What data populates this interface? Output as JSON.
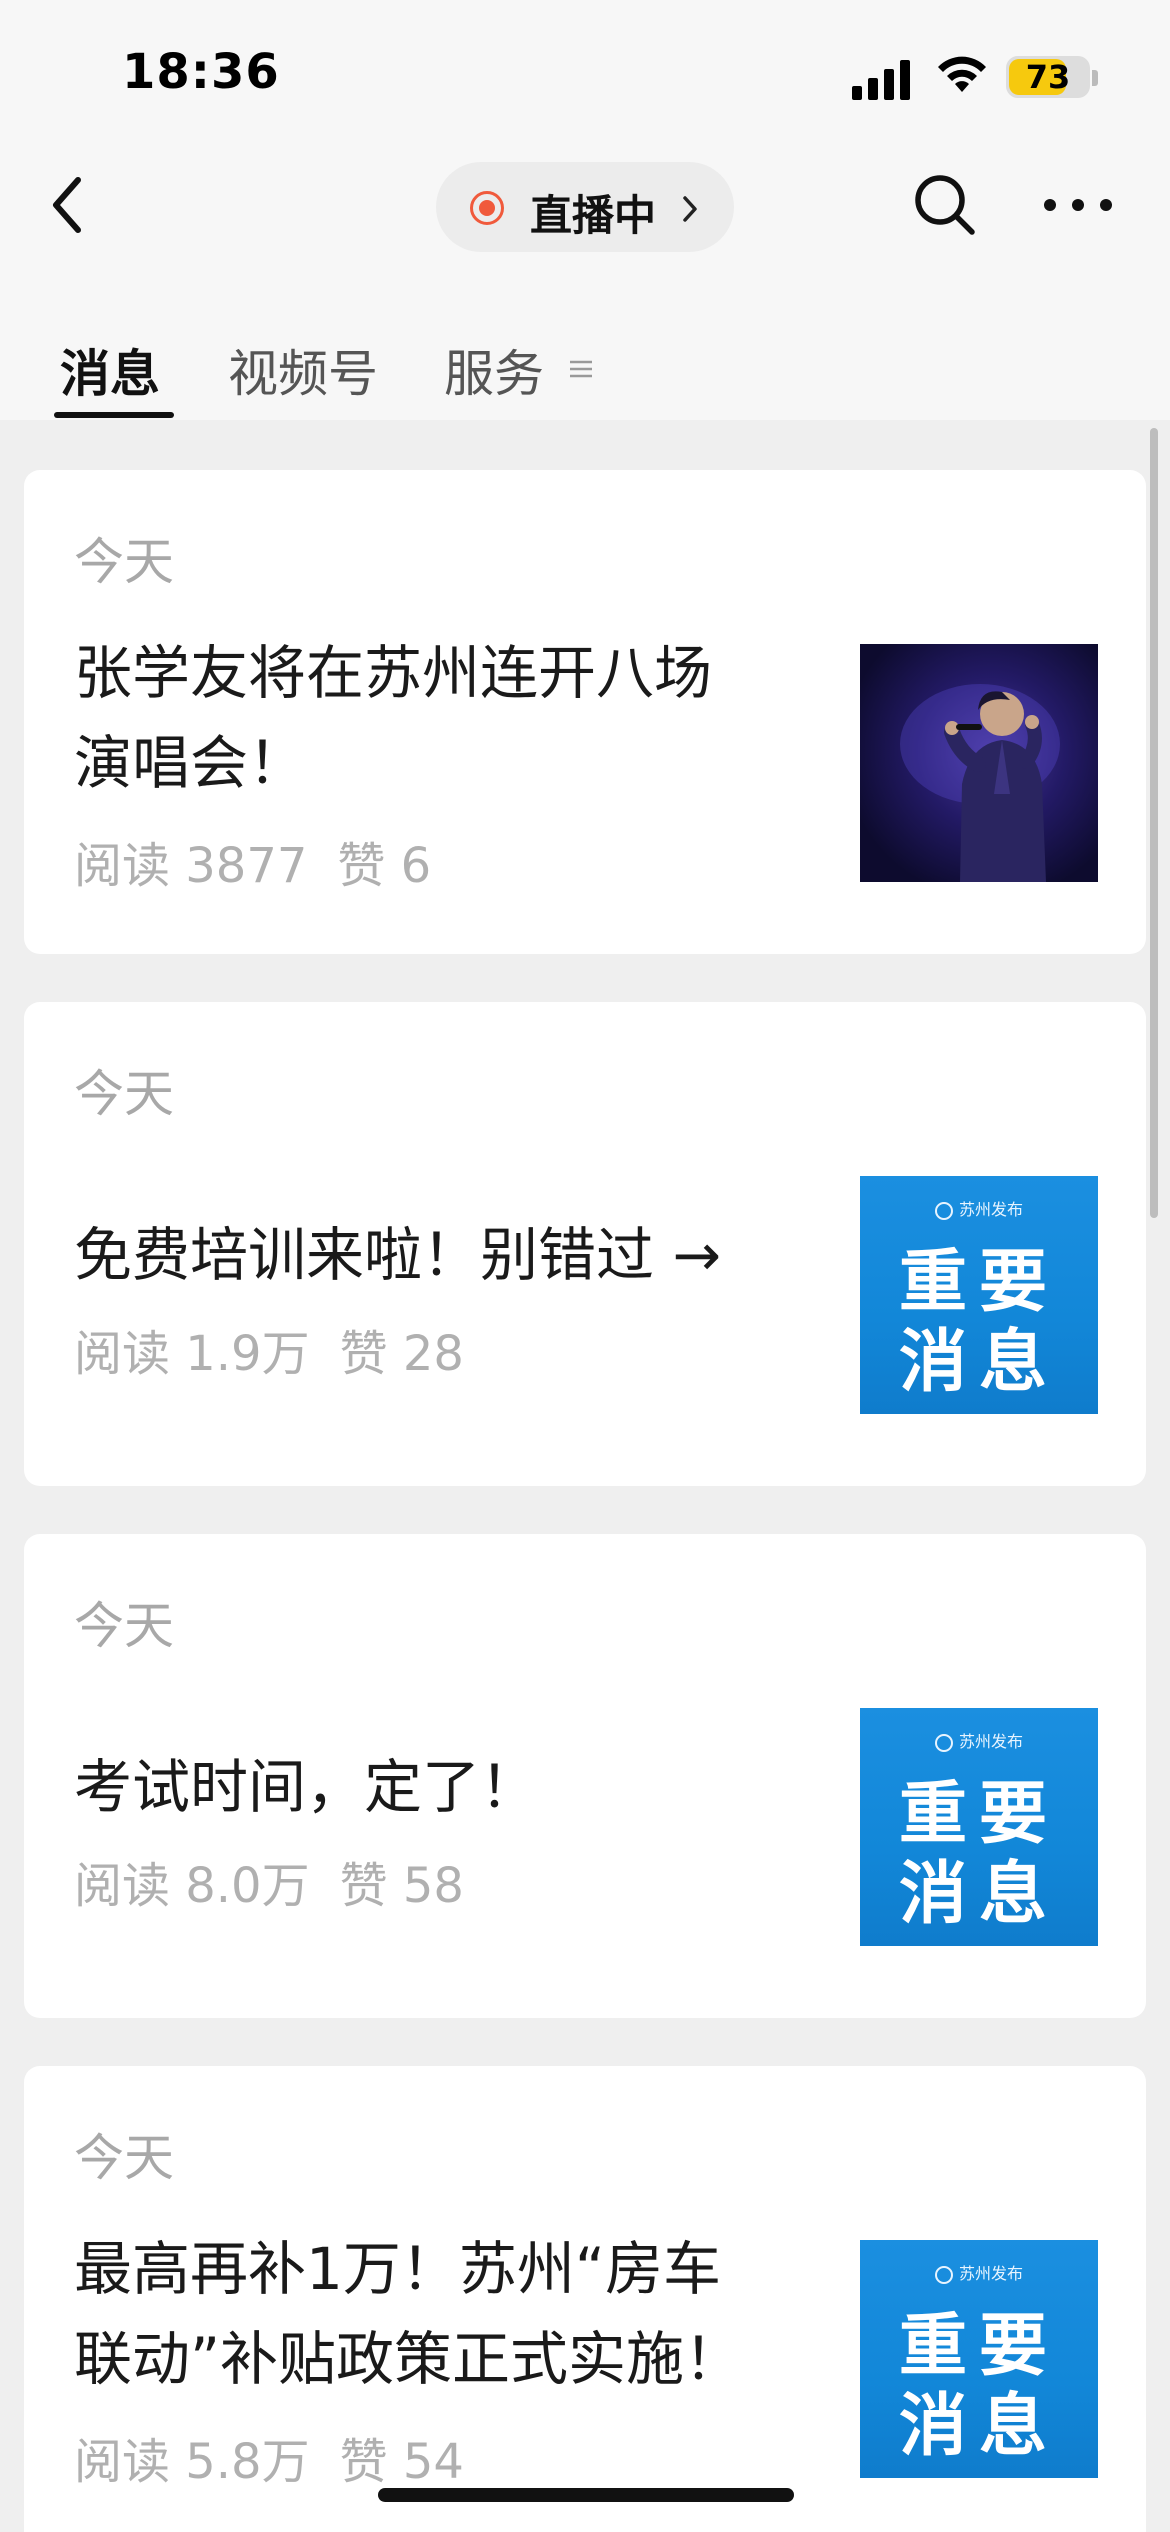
{
  "status_bar": {
    "time": "18:36",
    "battery_level": "73",
    "battery_fraction": 0.73,
    "battery_color": "#f6c90e"
  },
  "nav": {
    "back_icon": "chevron-left-icon",
    "live_label": "直播中",
    "live_color": "#f05a3c",
    "search_icon": "search-icon",
    "more_icon": "more-horizontal-icon"
  },
  "tabs": [
    {
      "label": "消息",
      "active": true
    },
    {
      "label": "视频号",
      "active": false
    },
    {
      "label": "服务",
      "active": false
    }
  ],
  "articles": [
    {
      "date": "今天",
      "title_lines": [
        "张学友将在苏州连开八场",
        "演唱会！"
      ],
      "reads": "阅读 3877",
      "likes": "赞 6",
      "thumbnail": "concert-photo"
    },
    {
      "date": "今天",
      "title_lines": [
        "免费培训来啦！别错过 →"
      ],
      "reads": "阅读 1.9万",
      "likes": "赞 28",
      "thumbnail": {
        "header": "苏州发布",
        "line1": "重要",
        "line2": "消息"
      }
    },
    {
      "date": "今天",
      "title_lines": [
        "考试时间，定了！"
      ],
      "reads": "阅读 8.0万",
      "likes": "赞 58",
      "thumbnail": {
        "header": "苏州发布",
        "line1": "重要",
        "line2": "消息"
      }
    },
    {
      "date": "今天",
      "title_lines": [
        "最高再补1万！苏州“房车",
        "联动”补贴政策正式实施！"
      ],
      "reads": "阅读 5.8万",
      "likes": "赞 54",
      "thumbnail": {
        "header": "苏州发布",
        "line1": "重要",
        "line2": "消息"
      }
    }
  ]
}
